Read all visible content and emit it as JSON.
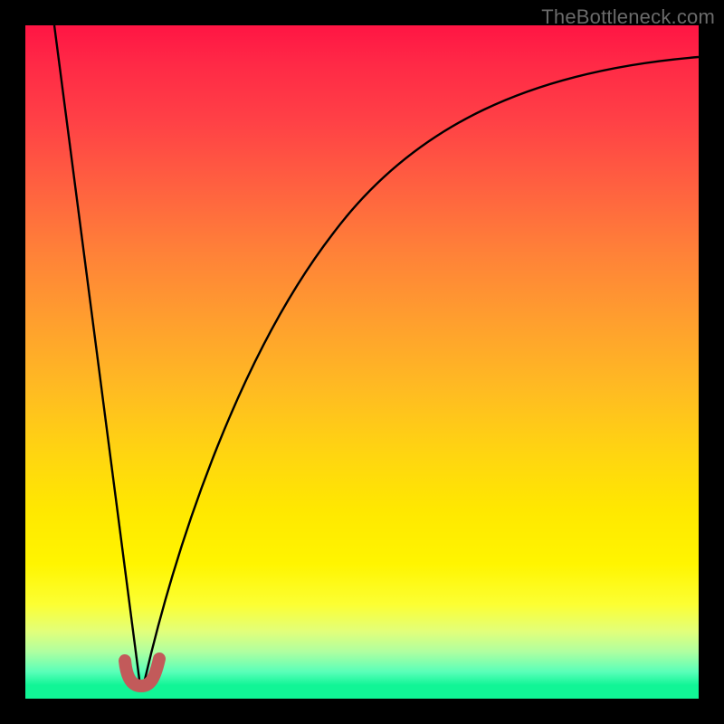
{
  "watermark": "TheBottleneck.com",
  "colors": {
    "background": "#000000",
    "curve_stroke": "#000000",
    "marker_stroke": "#c25a5a"
  },
  "chart_data": {
    "type": "line",
    "title": "",
    "xlabel": "",
    "ylabel": "",
    "xlim": [
      0,
      100
    ],
    "ylim": [
      0,
      100
    ],
    "series": [
      {
        "name": "left-branch",
        "x": [
          0,
          16
        ],
        "values": [
          100,
          2
        ]
      },
      {
        "name": "right-branch",
        "x": [
          16,
          20,
          25,
          30,
          35,
          40,
          45,
          50,
          55,
          60,
          65,
          70,
          75,
          80,
          85,
          90,
          95,
          100
        ],
        "values": [
          2,
          14,
          28,
          40,
          50,
          58,
          65,
          71,
          76,
          80,
          83.5,
          86.5,
          89,
          91,
          92.5,
          93.5,
          94.3,
          95
        ]
      },
      {
        "name": "bottom-marker",
        "x": [
          14,
          15,
          16,
          17,
          18,
          19
        ],
        "values": [
          4.5,
          2.5,
          2,
          2,
          2.5,
          5
        ]
      }
    ],
    "annotations": []
  }
}
